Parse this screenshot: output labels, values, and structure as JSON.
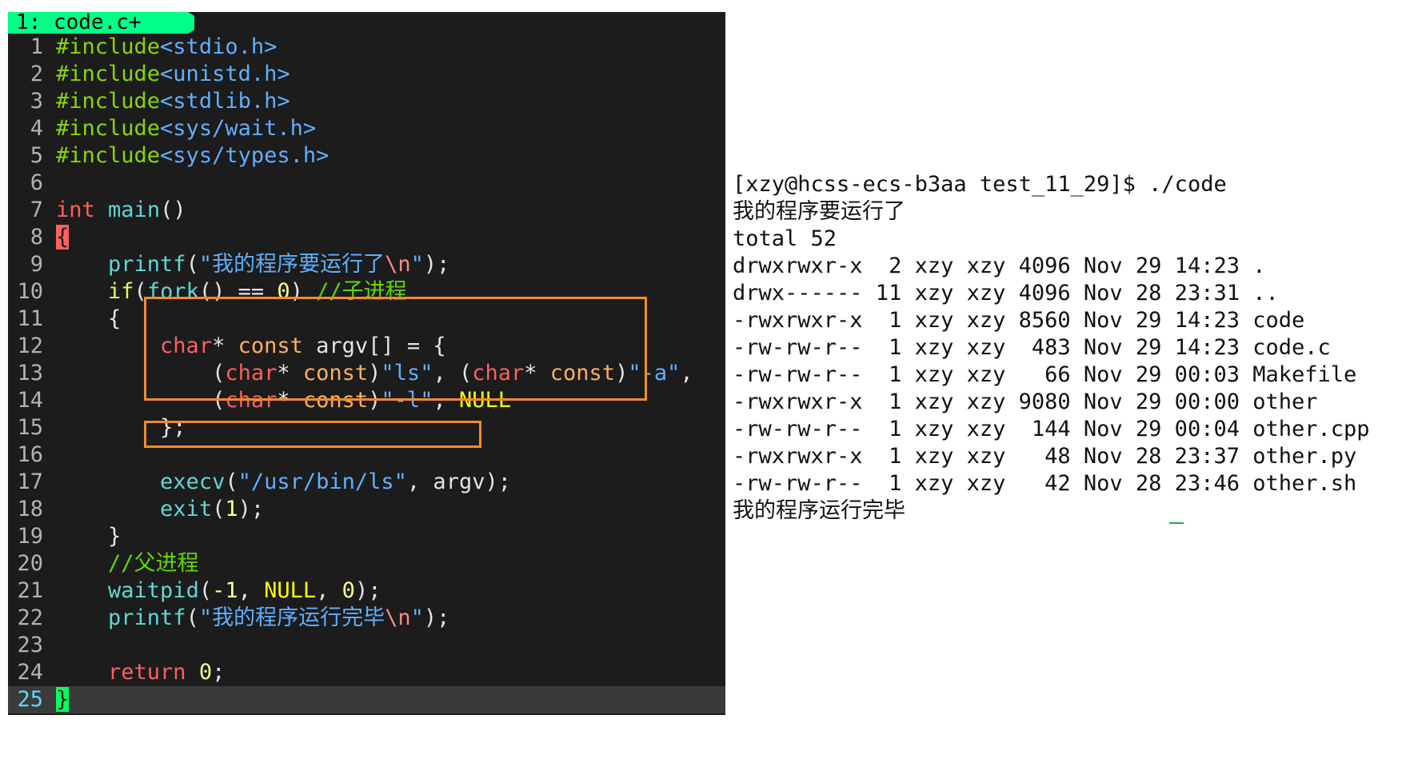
{
  "editor": {
    "tab_label": "1: code.c+",
    "lines": [
      {
        "num": "1",
        "parts": [
          {
            "c": "c-pre",
            "t": "#include"
          },
          {
            "c": "c-str",
            "t": "<stdio.h>"
          }
        ]
      },
      {
        "num": "2",
        "parts": [
          {
            "c": "c-pre",
            "t": "#include"
          },
          {
            "c": "c-str",
            "t": "<unistd.h>"
          }
        ]
      },
      {
        "num": "3",
        "parts": [
          {
            "c": "c-pre",
            "t": "#include"
          },
          {
            "c": "c-str",
            "t": "<stdlib.h>"
          }
        ]
      },
      {
        "num": "4",
        "parts": [
          {
            "c": "c-pre",
            "t": "#include"
          },
          {
            "c": "c-str",
            "t": "<sys/wait.h>"
          }
        ]
      },
      {
        "num": "5",
        "parts": [
          {
            "c": "c-pre",
            "t": "#include"
          },
          {
            "c": "c-str",
            "t": "<sys/types.h>"
          }
        ]
      },
      {
        "num": "6",
        "parts": []
      },
      {
        "num": "7",
        "parts": [
          {
            "c": "c-type",
            "t": "int"
          },
          {
            "c": "c-plain",
            "t": " "
          },
          {
            "c": "c-fn",
            "t": "main"
          },
          {
            "c": "c-plain",
            "t": "()"
          }
        ]
      },
      {
        "num": "8",
        "parts": [
          {
            "c": "br-red",
            "t": "{"
          }
        ]
      },
      {
        "num": "9",
        "parts": [
          {
            "c": "c-plain",
            "t": "    "
          },
          {
            "c": "c-fn",
            "t": "printf"
          },
          {
            "c": "c-plain",
            "t": "("
          },
          {
            "c": "c-str",
            "t": "\"我的程序要运行了"
          },
          {
            "c": "c-esc",
            "t": "\\n"
          },
          {
            "c": "c-str",
            "t": "\""
          },
          {
            "c": "c-plain",
            "t": ");"
          }
        ]
      },
      {
        "num": "10",
        "parts": [
          {
            "c": "c-plain",
            "t": "    "
          },
          {
            "c": "c-kw",
            "t": "if"
          },
          {
            "c": "c-plain",
            "t": "("
          },
          {
            "c": "c-fn",
            "t": "fork"
          },
          {
            "c": "c-plain",
            "t": "() == "
          },
          {
            "c": "c-num",
            "t": "0"
          },
          {
            "c": "c-plain",
            "t": ") "
          },
          {
            "c": "c-com",
            "t": "//子进程"
          }
        ]
      },
      {
        "num": "11",
        "parts": [
          {
            "c": "c-plain",
            "t": "    {"
          }
        ]
      },
      {
        "num": "12",
        "parts": [
          {
            "c": "c-plain",
            "t": "        "
          },
          {
            "c": "c-type",
            "t": "char"
          },
          {
            "c": "c-plain",
            "t": "* "
          },
          {
            "c": "c-qual",
            "t": "const"
          },
          {
            "c": "c-plain",
            "t": " argv[] = {"
          }
        ]
      },
      {
        "num": "13",
        "parts": [
          {
            "c": "c-plain",
            "t": "            ("
          },
          {
            "c": "c-type",
            "t": "char"
          },
          {
            "c": "c-plain",
            "t": "* "
          },
          {
            "c": "c-qual",
            "t": "const"
          },
          {
            "c": "c-plain",
            "t": ")"
          },
          {
            "c": "c-str",
            "t": "\"ls\""
          },
          {
            "c": "c-plain",
            "t": ", ("
          },
          {
            "c": "c-type",
            "t": "char"
          },
          {
            "c": "c-plain",
            "t": "* "
          },
          {
            "c": "c-qual",
            "t": "const"
          },
          {
            "c": "c-plain",
            "t": ")"
          },
          {
            "c": "c-str",
            "t": "\"-a\""
          },
          {
            "c": "c-plain",
            "t": ","
          }
        ]
      },
      {
        "num": "14",
        "parts": [
          {
            "c": "c-plain",
            "t": "            ("
          },
          {
            "c": "c-type",
            "t": "char"
          },
          {
            "c": "c-plain",
            "t": "* "
          },
          {
            "c": "c-qual",
            "t": "const"
          },
          {
            "c": "c-plain",
            "t": ")"
          },
          {
            "c": "c-str",
            "t": "\"-l\""
          },
          {
            "c": "c-plain",
            "t": ", "
          },
          {
            "c": "c-null",
            "t": "NULL"
          }
        ]
      },
      {
        "num": "15",
        "parts": [
          {
            "c": "c-plain",
            "t": "        };"
          }
        ]
      },
      {
        "num": "16",
        "parts": []
      },
      {
        "num": "17",
        "parts": [
          {
            "c": "c-plain",
            "t": "        "
          },
          {
            "c": "c-fn",
            "t": "execv"
          },
          {
            "c": "c-plain",
            "t": "("
          },
          {
            "c": "c-str",
            "t": "\"/usr/bin/ls\""
          },
          {
            "c": "c-plain",
            "t": ", argv);"
          }
        ]
      },
      {
        "num": "18",
        "parts": [
          {
            "c": "c-plain",
            "t": "        "
          },
          {
            "c": "c-fn",
            "t": "exit"
          },
          {
            "c": "c-plain",
            "t": "("
          },
          {
            "c": "c-num",
            "t": "1"
          },
          {
            "c": "c-plain",
            "t": ");"
          }
        ]
      },
      {
        "num": "19",
        "parts": [
          {
            "c": "c-plain",
            "t": "    }"
          }
        ]
      },
      {
        "num": "20",
        "parts": [
          {
            "c": "c-plain",
            "t": "    "
          },
          {
            "c": "c-com",
            "t": "//父进程"
          }
        ]
      },
      {
        "num": "21",
        "parts": [
          {
            "c": "c-plain",
            "t": "    "
          },
          {
            "c": "c-fn",
            "t": "waitpid"
          },
          {
            "c": "c-plain",
            "t": "("
          },
          {
            "c": "c-num",
            "t": "-1"
          },
          {
            "c": "c-plain",
            "t": ", "
          },
          {
            "c": "c-null",
            "t": "NULL"
          },
          {
            "c": "c-plain",
            "t": ", "
          },
          {
            "c": "c-num",
            "t": "0"
          },
          {
            "c": "c-plain",
            "t": ");"
          }
        ]
      },
      {
        "num": "22",
        "parts": [
          {
            "c": "c-plain",
            "t": "    "
          },
          {
            "c": "c-fn",
            "t": "printf"
          },
          {
            "c": "c-plain",
            "t": "("
          },
          {
            "c": "c-str",
            "t": "\"我的程序运行完毕"
          },
          {
            "c": "c-esc",
            "t": "\\n"
          },
          {
            "c": "c-str",
            "t": "\""
          },
          {
            "c": "c-plain",
            "t": ");"
          }
        ]
      },
      {
        "num": "23",
        "parts": []
      },
      {
        "num": "24",
        "parts": [
          {
            "c": "c-plain",
            "t": "    "
          },
          {
            "c": "c-type",
            "t": "return"
          },
          {
            "c": "c-plain",
            "t": " "
          },
          {
            "c": "c-num",
            "t": "0"
          },
          {
            "c": "c-plain",
            "t": ";"
          }
        ]
      },
      {
        "num": "25",
        "parts": [
          {
            "c": "br-green",
            "t": "}"
          }
        ],
        "current": true
      }
    ]
  },
  "terminal": {
    "lines": [
      "[xzy@hcss-ecs-b3aa test_11_29]$ ./code",
      "我的程序要运行了",
      "total 52",
      "drwxrwxr-x  2 xzy xzy 4096 Nov 29 14:23 .",
      "drwx------ 11 xzy xzy 4096 Nov 28 23:31 ..",
      "-rwxrwxr-x  1 xzy xzy 8560 Nov 29 14:23 code",
      "-rw-rw-r--  1 xzy xzy  483 Nov 29 14:23 code.c",
      "-rw-rw-r--  1 xzy xzy   66 Nov 29 00:03 Makefile",
      "-rwxrwxr-x  1 xzy xzy 9080 Nov 29 00:00 other",
      "-rw-rw-r--  1 xzy xzy  144 Nov 29 00:04 other.cpp",
      "-rwxrwxr-x  1 xzy xzy   48 Nov 28 23:37 other.py",
      "-rw-rw-r--  1 xzy xzy   42 Nov 28 23:46 other.sh",
      "我的程序运行完毕"
    ]
  },
  "colors": {
    "editor_bg": "#1c1c1c",
    "tab_bg": "#00ff87",
    "highlight_border": "#f28c28"
  }
}
